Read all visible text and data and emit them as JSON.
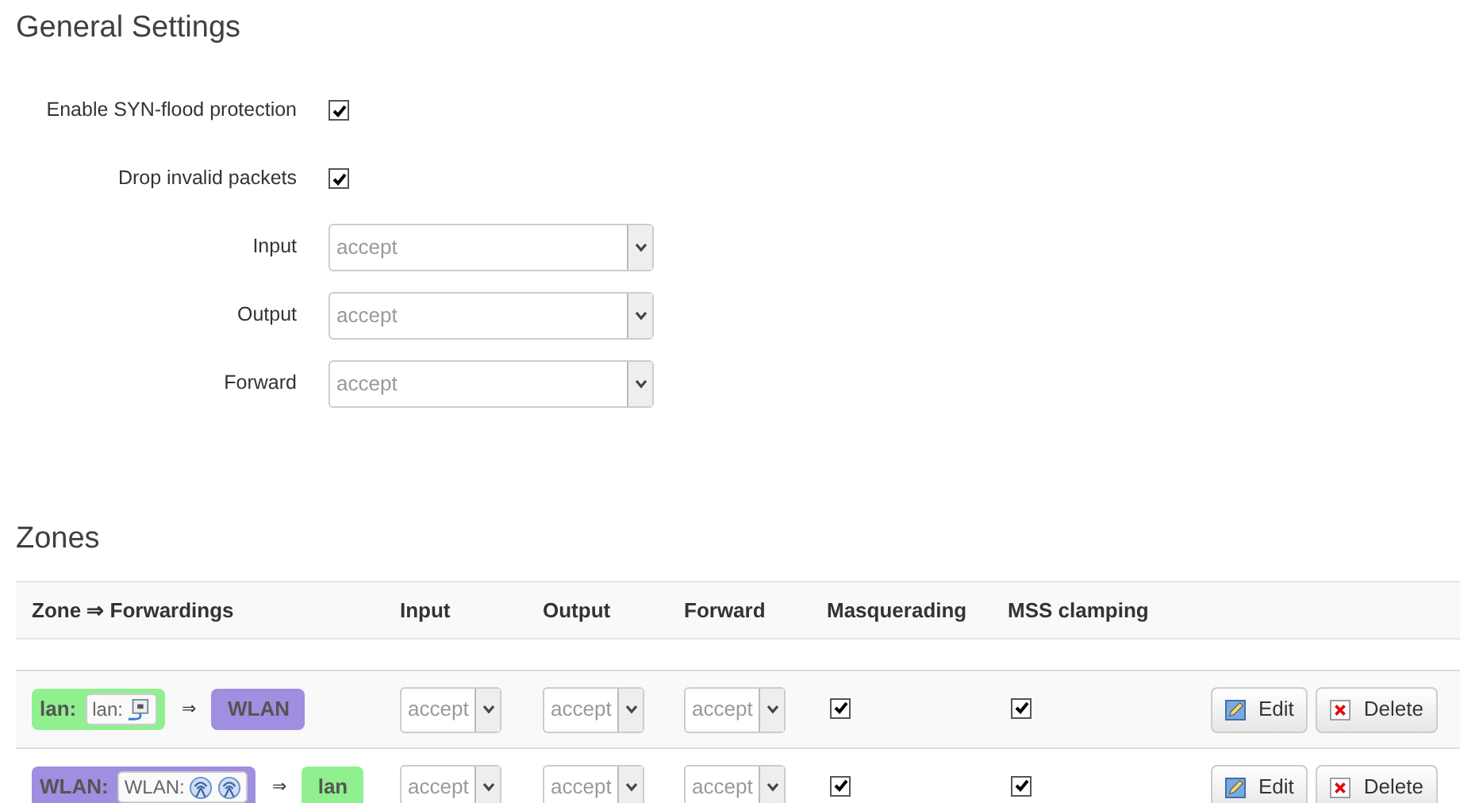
{
  "general": {
    "title": "General Settings",
    "options": [
      {
        "kind": "checkbox",
        "label": "Enable SYN-flood protection",
        "checked": true
      },
      {
        "kind": "checkbox",
        "label": "Drop invalid packets",
        "checked": true
      },
      {
        "kind": "select",
        "label": "Input",
        "value": "accept"
      },
      {
        "kind": "select",
        "label": "Output",
        "value": "accept"
      },
      {
        "kind": "select",
        "label": "Forward",
        "value": "accept"
      }
    ]
  },
  "zones": {
    "title": "Zones",
    "columns": [
      "Zone ⇒ Forwardings",
      "Input",
      "Output",
      "Forward",
      "Masquerading",
      "MSS clamping"
    ],
    "rows": [
      {
        "zone": {
          "name": "lan:",
          "color": "#90f090"
        },
        "network": {
          "label": "lan:",
          "icons": [
            {
              "kind": "ethernet"
            }
          ]
        },
        "arrow": "⇒",
        "dest": {
          "name": "WLAN",
          "color": "#a08ee0"
        },
        "input": "accept",
        "output": "accept",
        "forward": "accept",
        "masquerading": true,
        "mss_clamping": true,
        "edit": "Edit",
        "delete": "Delete"
      },
      {
        "zone": {
          "name": "WLAN:",
          "color": "#a08ee0"
        },
        "network": {
          "label": "WLAN:",
          "icons": [
            {
              "kind": "wireless"
            },
            {
              "kind": "wireless"
            }
          ]
        },
        "arrow": "⇒",
        "dest": {
          "name": "lan",
          "color": "#90f090"
        },
        "input": "accept",
        "output": "accept",
        "forward": "accept",
        "masquerading": true,
        "mss_clamping": true,
        "edit": "Edit",
        "delete": "Delete"
      }
    ]
  }
}
